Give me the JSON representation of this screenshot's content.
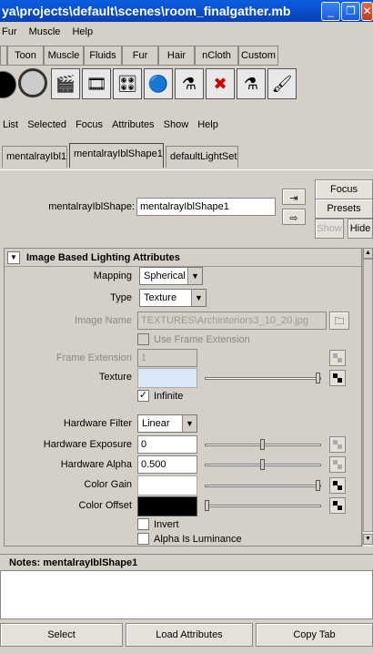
{
  "window": {
    "title": "ya\\projects\\default\\scenes\\room_finalgather.mb"
  },
  "main_menu": [
    "Fur",
    "Muscle",
    "Help"
  ],
  "shelf_tabs": [
    "Toon",
    "Muscle",
    "Fluids",
    "Fur",
    "Hair",
    "nCloth",
    "Custom"
  ],
  "shelf_icons": [
    "black-sphere-icon",
    "grey-sphere-icon",
    "render-view-icon",
    "ipr-render-icon",
    "render-settings-icon",
    "render-globals-icon",
    "shader-flask-icon",
    "delete-shader-icon",
    "flask-icon",
    "paint-effects-icon"
  ],
  "ae_menu": [
    "List",
    "Selected",
    "Focus",
    "Attributes",
    "Show",
    "Help"
  ],
  "node_tabs": [
    "mentalrayIbl1",
    "mentalrayIblShape1",
    "defaultLightSet"
  ],
  "header": {
    "node_label": "mentalrayIblShape:",
    "node_value": "mentalrayIblShape1",
    "focus": "Focus",
    "presets": "Presets",
    "show": "Show",
    "hide": "Hide"
  },
  "section": {
    "title": "Image Based Lighting Attributes",
    "mapping_label": "Mapping",
    "mapping_value": "Spherical",
    "type_label": "Type",
    "type_value": "Texture",
    "image_name_label": "Image Name",
    "image_name_value": "TEXTURES\\Archinteriors3_10_20.jpg",
    "use_frame_ext": "Use Frame Extension",
    "frame_ext_label": "Frame Extension",
    "frame_ext_value": "1",
    "texture_label": "Texture",
    "texture_color": "#d8e8f8",
    "infinite": "Infinite",
    "infinite_checked": true,
    "hw_filter_label": "Hardware Filter",
    "hw_filter_value": "Linear",
    "hw_exposure_label": "Hardware Exposure",
    "hw_exposure_value": "0",
    "hw_exposure_slider": 0.5,
    "hw_alpha_label": "Hardware Alpha",
    "hw_alpha_value": "0.500",
    "hw_alpha_slider": 0.5,
    "color_gain_label": "Color Gain",
    "color_gain_color": "#ffffff",
    "color_offset_label": "Color Offset",
    "color_offset_color": "#000000",
    "invert": "Invert",
    "alpha_lum": "Alpha Is Luminance"
  },
  "notes": {
    "label": "Notes:  mentalrayIblShape1"
  },
  "bottom": {
    "select": "Select",
    "load": "Load Attributes",
    "copy": "Copy Tab"
  }
}
